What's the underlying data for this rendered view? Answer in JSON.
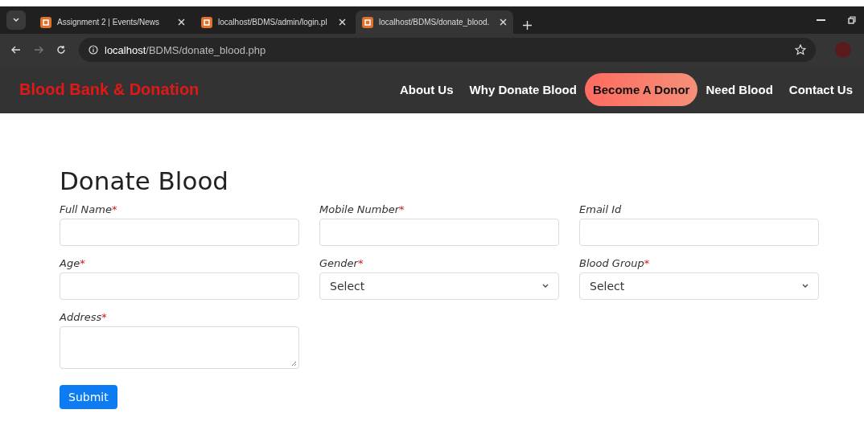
{
  "browser": {
    "tabs": [
      {
        "title": "Assignment 2 | Events/News",
        "selected": false
      },
      {
        "title": "localhost/BDMS/admin/login.pl",
        "selected": false
      },
      {
        "title": "localhost/BDMS/donate_blood.",
        "selected": true
      }
    ],
    "address": {
      "host": "localhost",
      "path": "/BDMS/donate_blood.php"
    }
  },
  "navbar": {
    "brand": "Blood Bank & Donation",
    "links": [
      {
        "label": "About Us",
        "selected": false
      },
      {
        "label": "Why Donate Blood",
        "selected": false
      },
      {
        "label": "Become A Donor",
        "selected": true
      },
      {
        "label": "Need Blood",
        "selected": false
      },
      {
        "label": "Contact Us",
        "selected": false
      }
    ]
  },
  "form": {
    "title": "Donate Blood",
    "fields": [
      {
        "kind": "text",
        "label": "Full Name",
        "mark": "*"
      },
      {
        "kind": "text",
        "label": "Mobile Number",
        "mark": "*"
      },
      {
        "kind": "text",
        "label": "Email Id"
      },
      {
        "kind": "text",
        "label": "Age",
        "mark": "*"
      },
      {
        "kind": "select",
        "label": "Gender",
        "mark": "*",
        "value": "Select"
      },
      {
        "kind": "select",
        "label": "Blood Group",
        "mark": "*",
        "value": "Select"
      },
      {
        "kind": "textarea",
        "label": "Address",
        "mark": "*"
      }
    ],
    "submit": "Submit"
  }
}
